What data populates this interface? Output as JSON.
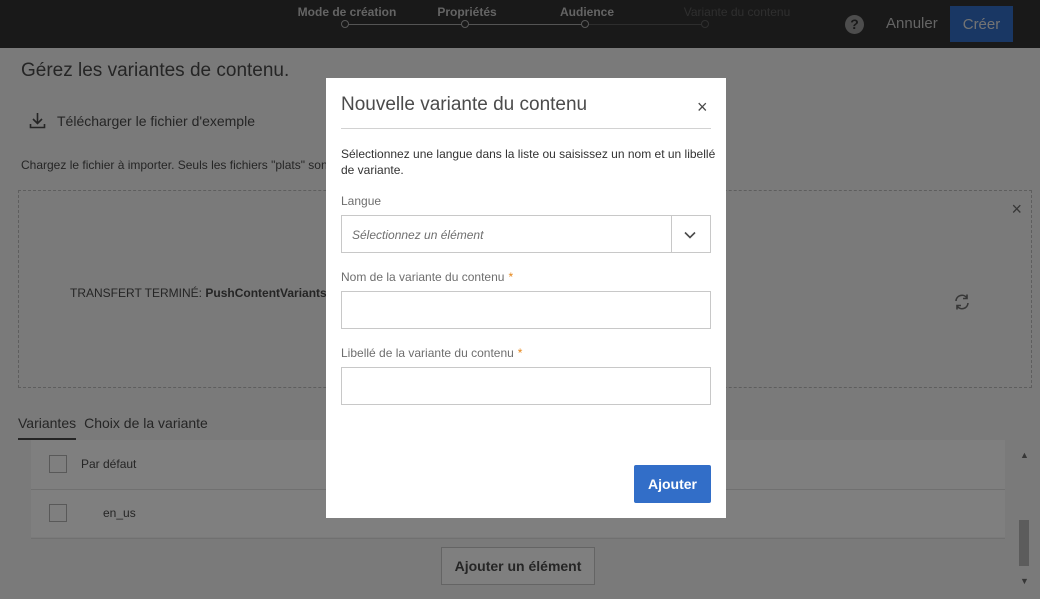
{
  "topbar": {
    "steps": [
      {
        "label": "Mode de création",
        "state": "done"
      },
      {
        "label": "Propriétés",
        "state": "done"
      },
      {
        "label": "Audience",
        "state": "done"
      },
      {
        "label": "Variante du contenu",
        "state": "current"
      }
    ],
    "help_label": "?",
    "cancel_label": "Annuler",
    "create_label": "Créer"
  },
  "page": {
    "title": "Gérez les variantes de contenu.",
    "download_label": "Télécharger le fichier d'exemple",
    "instructions": "Chargez le fichier à importer. Seuls les fichiers \"plats\" sont p",
    "dropzone": {
      "close_label": "×",
      "status_prefix": "TRANSFERT TERMINÉ: ",
      "file_name": "PushContentVariants.csv"
    },
    "tabs": [
      {
        "label": "Variantes",
        "active": true
      },
      {
        "label": "Choix de la variante",
        "active": false
      }
    ],
    "rows": [
      {
        "label": "Par défaut"
      },
      {
        "label": "en_us"
      }
    ],
    "add_item_label": "Ajouter un élément"
  },
  "modal": {
    "title": "Nouvelle variante du contenu",
    "close_label": "×",
    "description": "Sélectionnez une langue dans la liste ou saisissez un nom et un libellé de variante.",
    "language_label": "Langue",
    "language_placeholder": "Sélectionnez un élément",
    "name_label": "Nom de la variante du contenu",
    "name_value": "",
    "libelle_label": "Libellé de la variante du contenu",
    "libelle_value": "",
    "required_mark": "*",
    "add_label": "Ajouter"
  },
  "colors": {
    "topbar_bg": "#323232",
    "primary_blue": "#326ec8",
    "required_orange": "#e68619"
  }
}
